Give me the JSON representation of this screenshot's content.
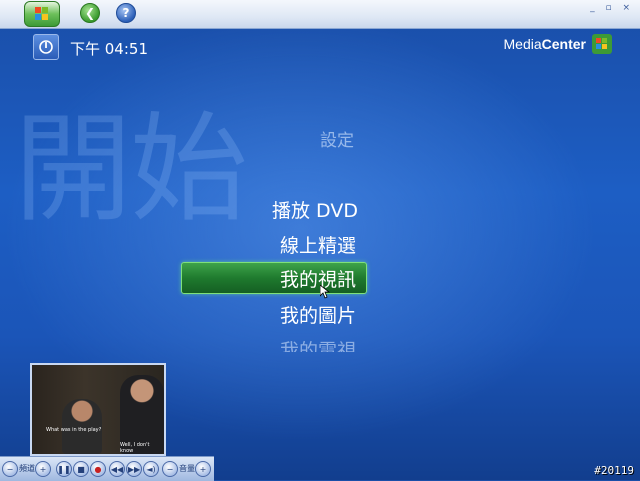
{
  "header": {
    "start_icon": "windows-flag-icon",
    "back_icon": "back-arrow-icon",
    "help_icon": "question-mark-icon",
    "window_controls": "_ ▫ ×"
  },
  "status": {
    "time": "下午 04:51"
  },
  "brand": {
    "name_plain": "Media",
    "name_bold": "Center"
  },
  "page": {
    "watermark": "開始"
  },
  "menu": {
    "items": [
      {
        "label": "設定"
      },
      {
        "label": "播放 DVD"
      },
      {
        "label": "線上精選"
      },
      {
        "label": "我的視訊"
      },
      {
        "label": "我的圖片"
      },
      {
        "label": "我的電視"
      }
    ],
    "selected": "我的視訊"
  },
  "preview": {
    "subtitle_left": "What was in the play?",
    "subtitle_right": "Well, I don't know"
  },
  "transport": {
    "channel_label": "頻道",
    "volume_label": "音量"
  },
  "image_id": "#20119",
  "colors": {
    "background": "#1d5ec4",
    "selection": "#1f7a2e",
    "accent_green": "#3d9a36"
  }
}
